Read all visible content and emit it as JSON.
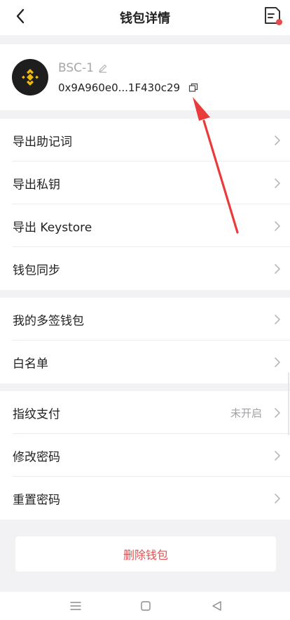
{
  "header": {
    "title": "钱包详情",
    "back_icon": "chevron-left-icon",
    "backup_icon": "backup-card-icon",
    "backup_dot_color": "#e84b4b"
  },
  "wallet": {
    "name": "BSC-1",
    "address": "0x9A960e0...1F430c29",
    "avatar_icon": "binance-logo-icon",
    "avatar_color": "#f0b90b"
  },
  "groups": [
    {
      "items": [
        {
          "label": "导出助记词"
        },
        {
          "label": "导出私钥"
        },
        {
          "label": "导出 Keystore"
        },
        {
          "label": "钱包同步"
        }
      ]
    },
    {
      "items": [
        {
          "label": "我的多签钱包"
        },
        {
          "label": "白名单"
        }
      ]
    },
    {
      "items": [
        {
          "label": "指纹支付",
          "value": "未开启"
        },
        {
          "label": "修改密码"
        },
        {
          "label": "重置密码"
        }
      ]
    }
  ],
  "delete_button": {
    "label": "删除钱包",
    "color": "#e05050"
  },
  "annotation": {
    "arrow_color": "#ea3b3b",
    "icon": "red-arrow-annotation"
  },
  "navbar": {
    "icons": [
      "menu-icon",
      "home-icon",
      "back-triangle-icon"
    ]
  }
}
